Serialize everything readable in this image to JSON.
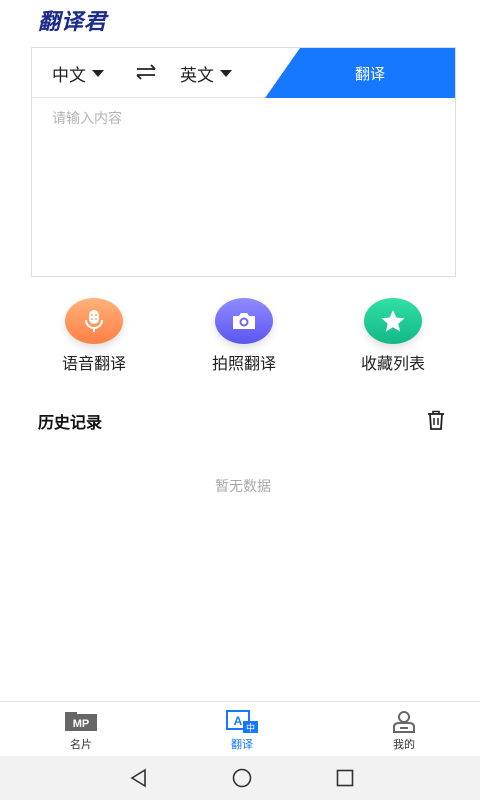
{
  "app": {
    "logo": "翻译君"
  },
  "translator": {
    "source_lang": "中文",
    "target_lang": "英文",
    "translate_button": "翻译",
    "input_placeholder": "请输入内容",
    "input_value": ""
  },
  "actions": [
    {
      "label": "语音翻译",
      "icon": "microphone-icon",
      "color": "#ff8c52"
    },
    {
      "label": "拍照翻译",
      "icon": "camera-icon",
      "color": "#6d68f5"
    },
    {
      "label": "收藏列表",
      "icon": "star-icon",
      "color": "#1fc893"
    }
  ],
  "history": {
    "title": "历史记录",
    "empty_text": "暂无数据"
  },
  "tabbar": [
    {
      "label": "名片",
      "icon": "card-mp-icon",
      "active": false
    },
    {
      "label": "翻译",
      "icon": "translate-icon",
      "active": true
    },
    {
      "label": "我的",
      "icon": "profile-icon",
      "active": false
    }
  ],
  "colors": {
    "accent": "#1677ff",
    "logo": "#1c2a8a"
  }
}
